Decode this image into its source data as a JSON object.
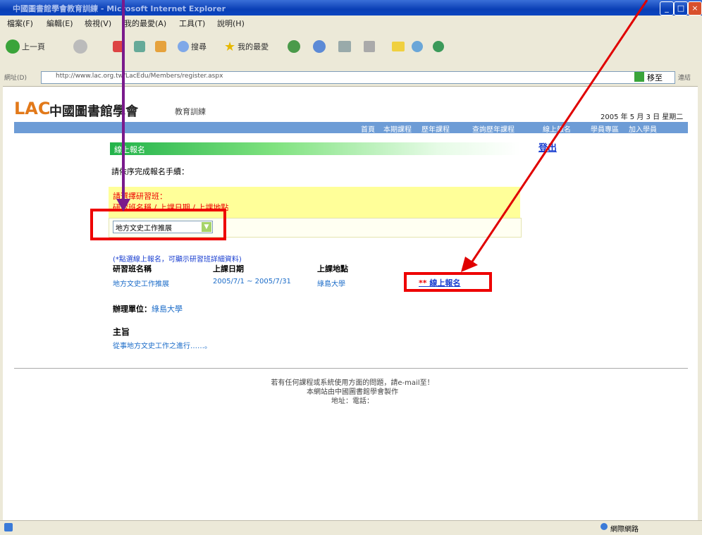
{
  "window": {
    "title": "中國圖書館學會教育訓練 - Microsoft Internet Explorer"
  },
  "menu": [
    "檔案(F)",
    "編輯(E)",
    "檢視(V)",
    "我的最愛(A)",
    "工具(T)",
    "說明(H)"
  ],
  "toolbar": {
    "back": "上一頁",
    "search": "搜尋",
    "favorites": "我的最愛"
  },
  "address": {
    "label": "網址(D)",
    "url": "http://www.lac.org.tw/LacEdu/Members/register.aspx",
    "go": "移至",
    "links": "連結"
  },
  "page": {
    "logo": "LAC",
    "logo_cn": "中國圖書館學會",
    "section": "教育訓練",
    "date": "2005 年 5 月 3 日 星期二",
    "nav": [
      "首頁",
      "本期課程",
      "歷年課程",
      "查詢歷年課程",
      "線上報名",
      "學員專區",
      "加入學員"
    ],
    "header_title": "線上報名",
    "logout": "登出",
    "instruction": "請依序完成報名手續：",
    "pick_title": "請選擇研習班：",
    "pick_sub": "研習班名稱 / 上課日期 / 上課地點",
    "selected_course": "地方文史工作推展",
    "note": "(*點選線上報名，可顯示研習班詳細資料)",
    "columns": {
      "name": "研習班名稱",
      "date": "上課日期",
      "place": "上課地點"
    },
    "row": {
      "name": "地方文史工作推展",
      "date": "2005/7/1 ~ 2005/7/31",
      "place": "綠島大學"
    },
    "register_stars": "**",
    "register_link": "線上報名",
    "organizer_label": "辦理單位：",
    "organizer": "綠島大學",
    "purpose_label": "主旨",
    "purpose": "從事地方文史工作之進行……。",
    "footer": [
      "若有任何課程或系統使用方面的問題，請e-mail至！",
      "本網站由中國圖書館學會製作",
      "地址：電話："
    ]
  },
  "status": {
    "zone": "網際網路"
  },
  "colors": {
    "annotation": "#e00000",
    "purple_arrow": "#7a1a8c",
    "nav_bg": "#6d9cd6",
    "logo": "#e2791a"
  }
}
